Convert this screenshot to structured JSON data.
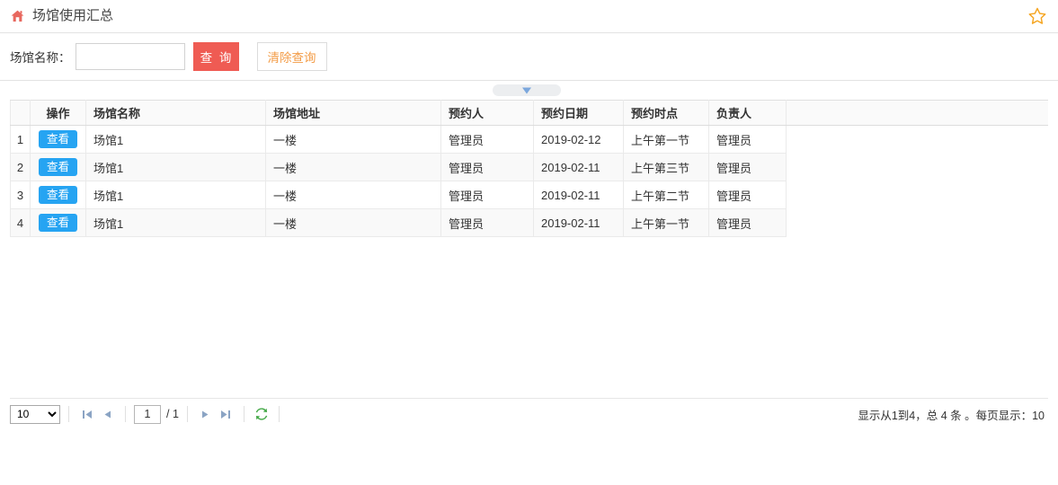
{
  "header": {
    "title": "场馆使用汇总",
    "home_icon": "home-icon",
    "favorite_icon": "star-icon"
  },
  "search": {
    "label": "场馆名称：",
    "input_value": "",
    "input_placeholder": "",
    "query_label": "查 询",
    "clear_label": "清除查询"
  },
  "collapse_toggle": {
    "icon": "caret-down-icon"
  },
  "table": {
    "columns": [
      {
        "key": "num",
        "label": ""
      },
      {
        "key": "op",
        "label": "操作"
      },
      {
        "key": "name",
        "label": "场馆名称"
      },
      {
        "key": "addr",
        "label": "场馆地址"
      },
      {
        "key": "person",
        "label": "预约人"
      },
      {
        "key": "date",
        "label": "预约日期"
      },
      {
        "key": "time",
        "label": "预约时点"
      },
      {
        "key": "owner",
        "label": "负责人"
      },
      {
        "key": "fill",
        "label": ""
      }
    ],
    "view_label": "查看",
    "rows": [
      {
        "num": "1",
        "name": "场馆1",
        "addr": "一楼",
        "person": "管理员",
        "date": "2019-02-12",
        "time": "上午第一节",
        "owner": "管理员"
      },
      {
        "num": "2",
        "name": "场馆1",
        "addr": "一楼",
        "person": "管理员",
        "date": "2019-02-11",
        "time": "上午第三节",
        "owner": "管理员"
      },
      {
        "num": "3",
        "name": "场馆1",
        "addr": "一楼",
        "person": "管理员",
        "date": "2019-02-11",
        "time": "上午第二节",
        "owner": "管理员"
      },
      {
        "num": "4",
        "name": "场馆1",
        "addr": "一楼",
        "person": "管理员",
        "date": "2019-02-11",
        "time": "上午第一节",
        "owner": "管理员"
      }
    ]
  },
  "pager": {
    "page_size_value": "10",
    "page_size_options": [
      "10"
    ],
    "first_icon": "first-page-icon",
    "prev_icon": "prev-page-icon",
    "next_icon": "next-page-icon",
    "last_icon": "last-page-icon",
    "refresh_icon": "refresh-icon",
    "page_number": "1",
    "page_total_text": "/ 1",
    "info_text": "显示从1到4，总 4 条 。每页显示：10"
  },
  "colors": {
    "query_button": "#ef5b53",
    "clear_button_text": "#f39c47",
    "view_button": "#26a4f2",
    "home_icon": "#e8685f",
    "star_icon": "#f5a623",
    "caret": "#7ba7dd",
    "refresh_icon": "#49ab4c"
  }
}
